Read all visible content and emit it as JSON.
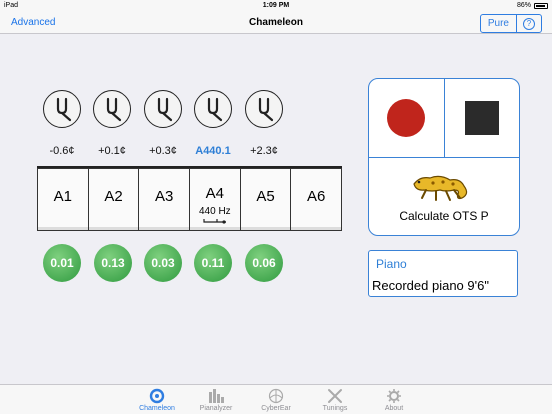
{
  "status_bar": {
    "device": "iPad",
    "time": "1:09 PM",
    "battery": "86%"
  },
  "nav": {
    "left": "Advanced",
    "title": "Chameleon",
    "right_button": "Pure",
    "help": "?"
  },
  "deviations": [
    "-0.6¢",
    "+0.1¢",
    "+0.3¢",
    "A440.1",
    "+2.3¢"
  ],
  "keys": [
    {
      "name": "A1"
    },
    {
      "name": "A2"
    },
    {
      "name": "A3"
    },
    {
      "name": "A4",
      "hz": "440 Hz"
    },
    {
      "name": "A5"
    },
    {
      "name": "A6"
    }
  ],
  "values": [
    "0.01",
    "0.13",
    "0.03",
    "0.11",
    "0.06"
  ],
  "panel": {
    "calc_label": "Calculate OTS P"
  },
  "piano": {
    "title": "Piano",
    "subtitle": "Recorded piano 9'6\""
  },
  "tabs": [
    {
      "label": "Chameleon",
      "icon": "chameleon-icon",
      "active": true
    },
    {
      "label": "Pianalyzer",
      "icon": "bar-chart-icon"
    },
    {
      "label": "CyberEar",
      "icon": "ear-icon"
    },
    {
      "label": "Tunings",
      "icon": "tools-icon"
    },
    {
      "label": "About",
      "icon": "gear-icon"
    }
  ],
  "colors": {
    "accent": "#2f7de1",
    "record": "#c0251c",
    "value_green": "#2f9a3f"
  }
}
